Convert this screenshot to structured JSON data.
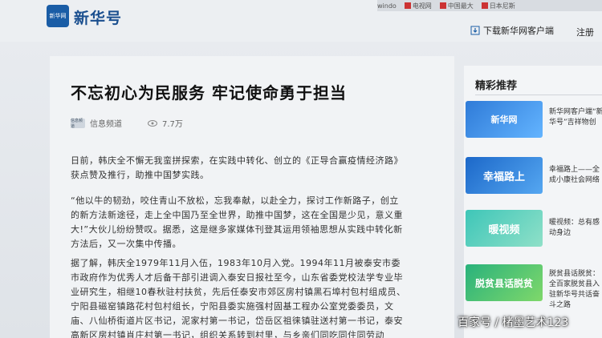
{
  "bookmarks": [
    "windo",
    "电视网",
    "中国最大",
    "日本尼斯"
  ],
  "header": {
    "logo_mark": "新华网",
    "logo_text": "新华号",
    "download_label": "下载新华网客户端",
    "login_label": "注册"
  },
  "article": {
    "title": "不忘初心为民服务 牢记使命勇于担当",
    "source": "信息频道",
    "source_icon_text": "信息频道",
    "views": "7.7万",
    "paragraphs": [
      "日前，韩庆全不懈无我蛮拼探索，在实践中转化、创立的《正导合赢疫情经济路》获点赞及推行，助推中国梦实践。",
      "“他以牛的韧劲，咬住青山不放松，忘我奉献，以赴全力，探讨工作新路子，创立的新方法新途径，走上全中国乃至全世界，助推中国梦，这在全国是少见，意义重大!”大伙儿纷纷赞叹。据悉，这是继多家媒体刊登其运用领袖思想从实践中转化新方法后，又一次集中传播。",
      "据了解，韩庆全1979年11月入伍，1983年10月入党。1994年11月被泰安市委市政府作为优秀人才后备干部引进调入泰安日报社至今，山东省委党校法学专业毕业研究生，相继10春秋驻村扶贫，先后任泰安市郊区房村镇黑石埠村包村组成员、宁阳县磁窑镇路花村包村组长，宁阳县委实施强村固基工程办公室党委委员，文庙、八仙桥街道片区书记，泥家村第一书记，岱岳区祖徕镇驻送村第一书记，泰安高新区房村镇肖庄村第一书记，组织关系转到村里，与乡亲们同吃同住同劳动"
    ]
  },
  "sidebar": {
    "title": "精彩推荐",
    "items": [
      {
        "thumb": "新华网",
        "text": "新华网客户端“新华号”吉祥物创"
      },
      {
        "thumb": "幸福路上",
        "text": "幸福路上——全成小康社会网络"
      },
      {
        "thumb": "暖视频",
        "text": "暖视频：总有感动身边"
      },
      {
        "thumb": "脱贫县话脱贫",
        "text": "脱贫县话脱贫：全百家脱贫县入驻新华号共话奋斗之路"
      }
    ]
  },
  "watermark": "百家号 / 楮墨艺术123"
}
